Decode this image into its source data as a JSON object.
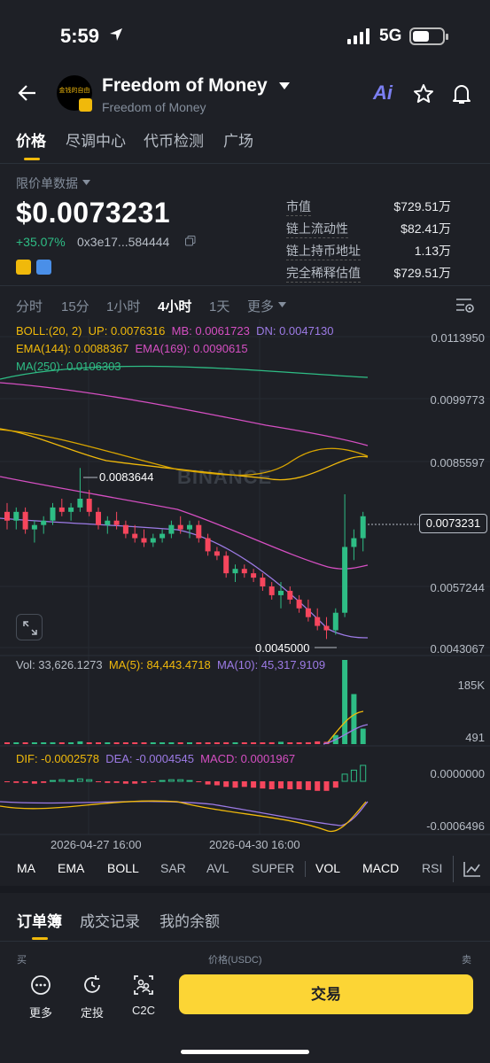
{
  "status": {
    "time": "5:59",
    "network": "5G"
  },
  "header": {
    "title": "Freedom of Money",
    "subtitle": "Freedom of Money",
    "logo_text": "金钱的自由",
    "ai_label": "Ai"
  },
  "tabs": [
    "价格",
    "尽调中心",
    "代币检测",
    "广场"
  ],
  "price": {
    "label": "限价单数据",
    "value": "$0.0073231",
    "change": "+35.07%",
    "address": "0x3e17...584444"
  },
  "stats": [
    {
      "k": "市值",
      "v": "$729.51万"
    },
    {
      "k": "链上流动性",
      "v": "$82.41万"
    },
    {
      "k": "链上持币地址",
      "v": "1.13万"
    },
    {
      "k": "完全稀释估值",
      "v": "$729.51万"
    }
  ],
  "timeframes": [
    "分时",
    "15分",
    "1小时",
    "4小时",
    "1天",
    "更多"
  ],
  "indicators": {
    "boll": "BOLL:(20, 2)",
    "up": "UP: 0.0076316",
    "mb": "MB: 0.0061723",
    "dn": "DN: 0.0047130",
    "ema144": "EMA(144): 0.0088367",
    "ema169": "EMA(169): 0.0090615",
    "ma250": "MA(250): 0.0106303",
    "vol": "Vol: 33,626.1273",
    "vol_ma5": "MA(5): 84,443.4718",
    "vol_ma10": "MA(10): 45,317.9109",
    "dif": "DIF: -0.0002578",
    "dea": "DEA: -0.0004545",
    "macd": "MACD: 0.0001967"
  },
  "price_axis": [
    "0.0113950",
    "0.0099773",
    "0.0085597",
    "0.0057244",
    "0.0043067"
  ],
  "current_price_tag": "0.0073231",
  "high_label": "0.0083644",
  "low_label": "0.0045000",
  "watermark": "BINANCE",
  "vol_axis": [
    "185K",
    "491"
  ],
  "macd_axis": [
    "0.0000000",
    "-0.0006496"
  ],
  "dates": [
    "2026-04-27 16:00",
    "2026-04-30 16:00"
  ],
  "indicator_tabs": [
    "MA",
    "EMA",
    "BOLL",
    "SAR",
    "AVL",
    "SUPER",
    "VOL",
    "MACD",
    "RSI"
  ],
  "bottom_tabs": [
    "订单簿",
    "成交记录",
    "我的余额"
  ],
  "orderbook": {
    "buy": "买",
    "price": "价格(USDC)",
    "sell": "卖"
  },
  "footer": {
    "more": "更多",
    "dca": "定投",
    "c2c": "C2C",
    "trade": "交易"
  },
  "colors": {
    "up": "#2ebd85",
    "down": "#f6465d",
    "accent": "#fcd535",
    "boll_up": "#f0b90b",
    "ma_line": "#9d7be6",
    "ema_pink": "#d54fc2",
    "ma250": "#2ebd85"
  },
  "chart_data": {
    "type": "candlestick",
    "price_axis_ticks": [
      0.011395,
      0.0099773,
      0.0085597,
      0.0057244,
      0.0043067
    ],
    "high": 0.0083644,
    "low": 0.0045,
    "last": 0.0073231,
    "x_ticks": [
      "2026-04-27 16:00",
      "2026-04-30 16:00"
    ],
    "candles": [
      [
        0.0074,
        0.0076,
        0.007,
        0.0072
      ],
      [
        0.0072,
        0.0075,
        0.007,
        0.0074
      ],
      [
        0.0074,
        0.0075,
        0.0069,
        0.007
      ],
      [
        0.007,
        0.0072,
        0.0067,
        0.0071
      ],
      [
        0.0071,
        0.0073,
        0.0069,
        0.0072
      ],
      [
        0.0072,
        0.0076,
        0.0071,
        0.0075
      ],
      [
        0.0075,
        0.0077,
        0.0073,
        0.0074
      ],
      [
        0.0074,
        0.0076,
        0.0072,
        0.0075
      ],
      [
        0.0075,
        0.0084,
        0.0074,
        0.0077
      ],
      [
        0.0077,
        0.0079,
        0.0073,
        0.0074
      ],
      [
        0.0074,
        0.0075,
        0.007,
        0.0071
      ],
      [
        0.0071,
        0.0073,
        0.0069,
        0.0072
      ],
      [
        0.0072,
        0.0074,
        0.007,
        0.0071
      ],
      [
        0.0071,
        0.0072,
        0.0068,
        0.0069
      ],
      [
        0.0069,
        0.0071,
        0.0067,
        0.0068
      ],
      [
        0.0068,
        0.007,
        0.0066,
        0.0067
      ],
      [
        0.0067,
        0.0069,
        0.0066,
        0.0068
      ],
      [
        0.0068,
        0.007,
        0.0067,
        0.0069
      ],
      [
        0.0069,
        0.0072,
        0.0068,
        0.0071
      ],
      [
        0.0071,
        0.0073,
        0.0069,
        0.007
      ],
      [
        0.007,
        0.0072,
        0.0068,
        0.0071
      ],
      [
        0.0071,
        0.0072,
        0.0067,
        0.0068
      ],
      [
        0.0068,
        0.0069,
        0.0064,
        0.0065
      ],
      [
        0.0065,
        0.0066,
        0.0063,
        0.0064
      ],
      [
        0.0064,
        0.0065,
        0.0059,
        0.006
      ],
      [
        0.006,
        0.0062,
        0.0058,
        0.0061
      ],
      [
        0.0061,
        0.0062,
        0.0059,
        0.006
      ],
      [
        0.006,
        0.0061,
        0.0058,
        0.0059
      ],
      [
        0.0059,
        0.006,
        0.0056,
        0.0057
      ],
      [
        0.0057,
        0.0058,
        0.0054,
        0.0055
      ],
      [
        0.0055,
        0.0058,
        0.0052,
        0.0056
      ],
      [
        0.0056,
        0.0057,
        0.0053,
        0.0054
      ],
      [
        0.0054,
        0.0055,
        0.0051,
        0.0052
      ],
      [
        0.0052,
        0.0054,
        0.0049,
        0.005
      ],
      [
        0.005,
        0.0052,
        0.0047,
        0.0048
      ],
      [
        0.0048,
        0.005,
        0.0045,
        0.0047
      ],
      [
        0.0047,
        0.0052,
        0.0046,
        0.0051
      ],
      [
        0.0051,
        0.0078,
        0.005,
        0.0066
      ],
      [
        0.0066,
        0.007,
        0.0063,
        0.0068
      ],
      [
        0.0068,
        0.0074,
        0.0065,
        0.0073
      ]
    ],
    "volume": [
      2,
      3,
      2,
      3,
      2,
      4,
      3,
      2,
      6,
      3,
      2,
      2,
      3,
      2,
      2,
      3,
      2,
      2,
      3,
      2,
      2,
      3,
      3,
      2,
      4,
      3,
      2,
      2,
      3,
      4,
      5,
      3,
      3,
      4,
      6,
      5,
      20,
      185,
      110,
      34
    ],
    "macd_hist": [
      -1e-05,
      -2e-05,
      -2e-05,
      -3e-05,
      -2e-05,
      1e-05,
      2e-05,
      1e-05,
      3e-05,
      2e-05,
      -1e-05,
      -2e-05,
      -2e-05,
      -3e-05,
      -3e-05,
      -2e-05,
      -1e-05,
      1e-05,
      2e-05,
      2e-05,
      1e-05,
      -1e-05,
      -4e-05,
      -5e-05,
      -7e-05,
      -8e-05,
      -7e-05,
      -8e-05,
      -9e-05,
      -0.0001,
      -9e-05,
      -0.0001,
      -0.0001,
      -0.00011,
      -0.00012,
      -0.00012,
      -8e-05,
      9e-05,
      0.00014,
      0.0002
    ]
  }
}
